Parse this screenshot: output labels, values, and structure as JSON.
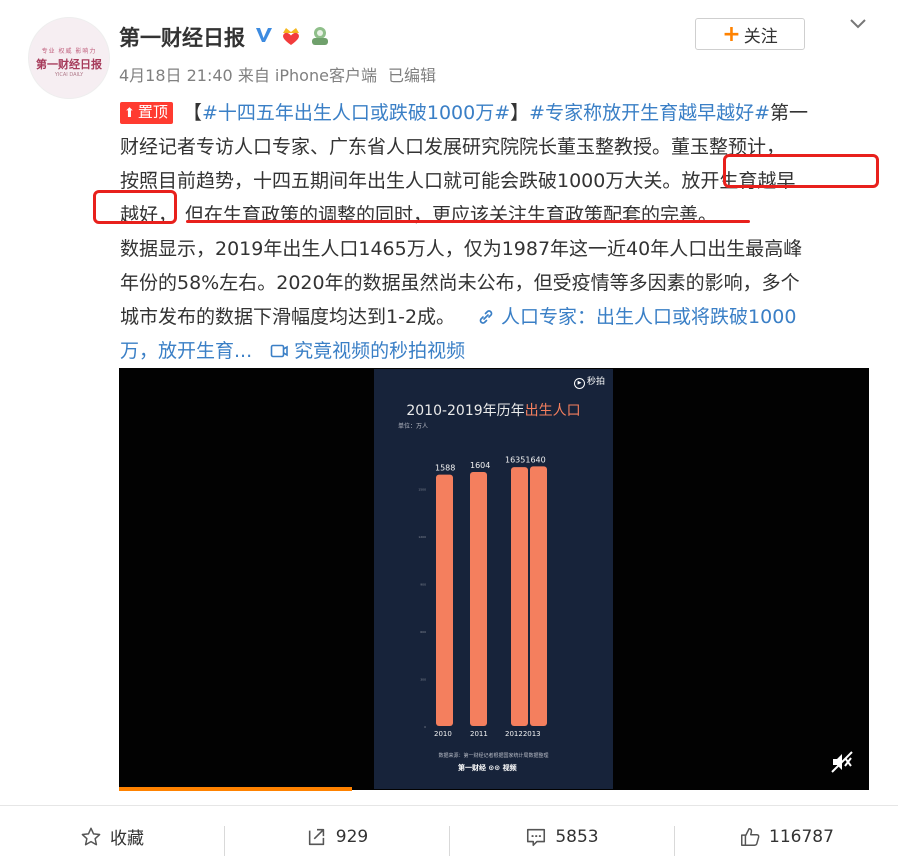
{
  "author": {
    "name": "第一财经日报",
    "avatar_top": "专业  权威  影响力",
    "avatar_main": "第一财经日报",
    "avatar_bottom": "YICAI DAILY"
  },
  "meta": {
    "date": "4月18日 21:40",
    "source": "来自 iPhone客户端",
    "edited": "已编辑"
  },
  "follow_label": "关注",
  "post": {
    "pin_label": "置顶",
    "line1_bracket_open": "【",
    "hashtag1": "#十四五年出生人口或跌破1000万#",
    "line1_bracket_close": "】",
    "hashtag2": "#专家称放开生育越早越好#",
    "line1_tail": "第一",
    "line2": "财经记者专访人口专家、广东省人口发展研究院院长董玉整教授。董玉整预计，",
    "line3_a": "按照目前趋势，十四五期间年出生人口就可能会跌破1000万大关。",
    "line3_b": "放开生育越早",
    "line4_a": "越好，",
    "line4_b": "但在生育政策的调整的同时，更应该关注生育政策配套的完善",
    "line4_c": "。",
    "line5": "数据显示，2019年出生人口1465万人，仅为1987年这一近40年人口出生最高峰",
    "line6": "年份的58%左右。2020年的数据虽然尚未公布，但受疫情等多因素的影响，多个",
    "line7_a": "城市发布的数据下滑幅度均达到1-2成。",
    "link1_a": "人口专家：出生人口或将跌破1000",
    "link1_b": "万，放开生育...",
    "link2": "究竟视频的秒拍视频"
  },
  "video": {
    "miaopai": "秒拍",
    "title_a": "2010-2019年历年",
    "title_b": "出生人口",
    "unit": "单位：万人",
    "source": "数据来源：第一财经记者根据国家统计局数据整理",
    "logos": "第一财经  ⊙⊙ 视频",
    "bar_color": "#f47f5e"
  },
  "chart_data": {
    "type": "bar",
    "title": "2010-2019年历年出生人口",
    "unit": "单位：万人",
    "categories": [
      "2010",
      "2011",
      "2012",
      "2013"
    ],
    "values": [
      1588,
      1604,
      1635,
      1640
    ],
    "value_labels": [
      "1588",
      "1604",
      "16351640"
    ],
    "x_labels": [
      "2010",
      "2011",
      "20122013"
    ],
    "ylim": [
      0,
      1800
    ]
  },
  "actions": {
    "favorite": "收藏",
    "repost": "929",
    "comment": "5853",
    "like": "116787"
  },
  "colors": {
    "accent": "#ff8200",
    "link": "#3a7fc6",
    "highlight": "#e8201c"
  }
}
